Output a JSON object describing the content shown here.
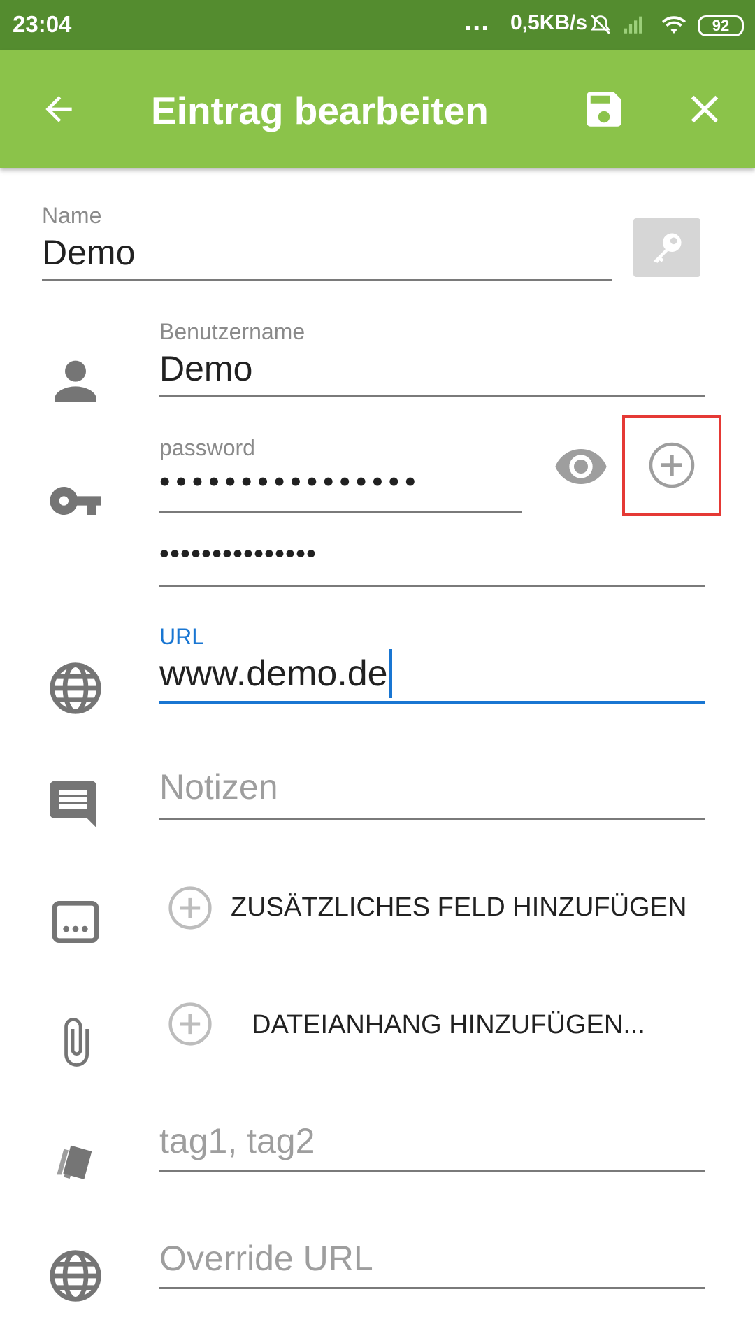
{
  "status_bar": {
    "time": "23:04",
    "dots": "...",
    "speed": "0,5KB/s",
    "battery": "92"
  },
  "app_bar": {
    "title": "Eintrag bearbeiten",
    "back_icon": "arrow-left-icon",
    "save_icon": "save-icon",
    "close_icon": "close-icon",
    "background": "#8bc34a",
    "status_background": "#548c2f"
  },
  "form": {
    "name": {
      "label": "Name",
      "value": "Demo"
    },
    "username": {
      "label": "Benutzername",
      "value": "Demo"
    },
    "password": {
      "label": "password",
      "masked": "••••••••••••••••",
      "confirm_masked": "•••••••••••••••"
    },
    "url": {
      "label": "URL",
      "value": "www.demo.de"
    },
    "notes": {
      "placeholder": "Notizen"
    },
    "add_field_label": "ZUSÄTZLICHES FELD HINZUFÜGEN",
    "add_attachment_label": "DATEIANHANG HINZUFÜGEN...",
    "tags": {
      "placeholder": "tag1, tag2"
    },
    "override_url": {
      "placeholder": "Override URL"
    }
  },
  "colors": {
    "accent": "#1976d2",
    "highlight": "#e53935"
  }
}
